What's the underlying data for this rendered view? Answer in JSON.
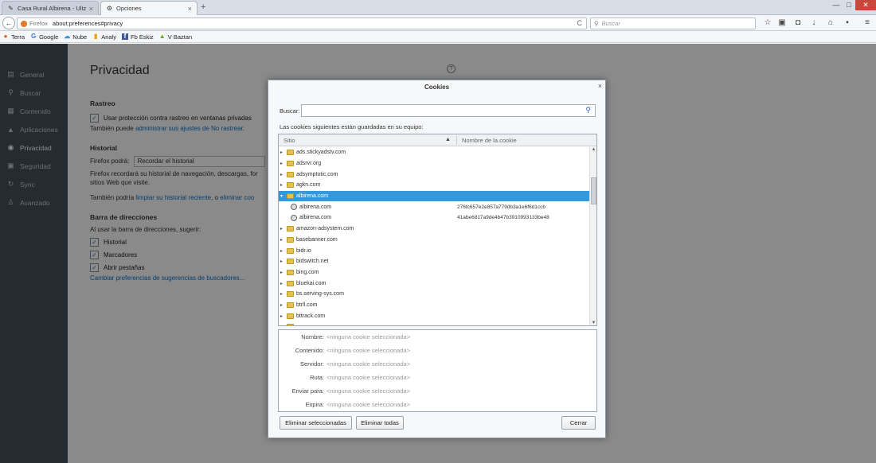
{
  "tabs": [
    {
      "label": "Casa Rural Albirena - Ultza...",
      "icon": "✎",
      "close": "×"
    },
    {
      "label": "Opciones",
      "icon": "⚙",
      "close": "×"
    }
  ],
  "new_tab": "+",
  "window_controls": {
    "minimize": "—",
    "maximize": "□",
    "close": "✕"
  },
  "navbar": {
    "back": "←",
    "identity_label": "Firefox",
    "url": "about:preferences#privacy",
    "reload": "C",
    "search_placeholder": "Buscar",
    "toolbar_icons": [
      {
        "name": "bookmark-star-icon",
        "glyph": "☆"
      },
      {
        "name": "clipboard-icon",
        "glyph": "▣"
      },
      {
        "name": "pocket-icon",
        "glyph": "◘"
      },
      {
        "name": "download-icon",
        "glyph": "↓"
      },
      {
        "name": "home-icon",
        "glyph": "⌂"
      },
      {
        "name": "addon-icon",
        "glyph": "▪"
      },
      {
        "name": "menu-icon",
        "glyph": "≡"
      }
    ]
  },
  "bookmarks": [
    {
      "label": "Terra",
      "icon": "●",
      "color": "#e05a18"
    },
    {
      "label": "Google",
      "icon": "G",
      "color": "#3a76d8"
    },
    {
      "label": "Nube",
      "icon": "☁",
      "color": "#2e9ad6"
    },
    {
      "label": "Analy",
      "icon": "▮",
      "color": "#e7a417"
    },
    {
      "label": "Fb Eskiz",
      "icon": "f",
      "color": "#3b5998"
    },
    {
      "label": "V Baztan",
      "icon": "▲",
      "color": "#6ea32f"
    }
  ],
  "sidebar": {
    "items": [
      {
        "label": "General",
        "icon": "▤"
      },
      {
        "label": "Buscar",
        "icon": "⚲"
      },
      {
        "label": "Contenido",
        "icon": "▦"
      },
      {
        "label": "Aplicaciones",
        "icon": "▲"
      },
      {
        "label": "Privacidad",
        "icon": "◉"
      },
      {
        "label": "Seguridad",
        "icon": "▣"
      },
      {
        "label": "Sync",
        "icon": "↻"
      },
      {
        "label": "Avanzado",
        "icon": "♙"
      }
    ]
  },
  "content": {
    "heading": "Privacidad",
    "help": "?",
    "rastreo": {
      "title": "Rastreo",
      "checkbox": "Usar protección contra rastreo en ventanas privadas",
      "also_prefix": "También puede ",
      "also_link": "administrar sus ajustes de No rastrear",
      "also_suffix": "."
    },
    "historial": {
      "title": "Historial",
      "firefox_label": "Firefox podrá:",
      "select_value": "Recordar el historial",
      "desc1": "Firefox recordará su historial de navegación, descargas, for",
      "desc2": "sitios Web que visite.",
      "also_prefix": "También podría ",
      "also_link1": "limpiar su historial reciente",
      "also_mid": ", o ",
      "also_link2": "eliminar coo"
    },
    "barra": {
      "title": "Barra de direcciones",
      "subtitle": "Al usar la barra de direcciones, sugerir:",
      "checks": [
        "Historial",
        "Marcadores",
        "Abrir pestañas"
      ],
      "link": "Cambiar preferencias de sugerencias de buscadores..."
    }
  },
  "dialog": {
    "title": "Cookies",
    "close": "×",
    "search_label": "Buscar:",
    "search_value": "",
    "stored_label": "Las cookies siguientes están guardadas en su equipo:",
    "col_site": "Sitio",
    "col_name": "Nombre de la cookie",
    "rows": [
      {
        "kind": "folder",
        "site": "ads.stickyadstv.com",
        "name": ""
      },
      {
        "kind": "folder",
        "site": "adsrvr.org",
        "name": ""
      },
      {
        "kind": "folder",
        "site": "adsymptotic.com",
        "name": ""
      },
      {
        "kind": "folder",
        "site": "agkn.com",
        "name": ""
      },
      {
        "kind": "folder-open",
        "site": "albirena.com",
        "name": "",
        "selected": true
      },
      {
        "kind": "cookie",
        "site": "albirena.com",
        "name": "276fc657e2e857a779db3a1e6f6d1ccb"
      },
      {
        "kind": "cookie",
        "site": "albirena.com",
        "name": "41abe6817a9de4b47b3910993133be48"
      },
      {
        "kind": "folder",
        "site": "amazon-adsystem.com",
        "name": ""
      },
      {
        "kind": "folder",
        "site": "basebanner.com",
        "name": ""
      },
      {
        "kind": "folder",
        "site": "bidr.io",
        "name": ""
      },
      {
        "kind": "folder",
        "site": "bidswitch.net",
        "name": ""
      },
      {
        "kind": "folder",
        "site": "bing.com",
        "name": ""
      },
      {
        "kind": "folder",
        "site": "bluekai.com",
        "name": ""
      },
      {
        "kind": "folder",
        "site": "bs.serving-sys.com",
        "name": ""
      },
      {
        "kind": "folder",
        "site": "btrll.com",
        "name": ""
      },
      {
        "kind": "folder",
        "site": "bttrack.com",
        "name": ""
      },
      {
        "kind": "folder",
        "site": "",
        "name": ""
      }
    ],
    "details": [
      {
        "label": "Nombre:",
        "value": "<ninguna cookie seleccionada>"
      },
      {
        "label": "Contenido:",
        "value": "<ninguna cookie seleccionada>"
      },
      {
        "label": "Servidor:",
        "value": "<ninguna cookie seleccionada>"
      },
      {
        "label": "Ruta:",
        "value": "<ninguna cookie seleccionada>"
      },
      {
        "label": "Enviar para:",
        "value": "<ninguna cookie seleccionada>"
      },
      {
        "label": "Expira:",
        "value": "<ninguna cookie seleccionada>"
      }
    ],
    "btn_delete_selected": "Eliminar seleccionadas",
    "btn_delete_all": "Eliminar todas",
    "btn_close": "Cerrar"
  }
}
